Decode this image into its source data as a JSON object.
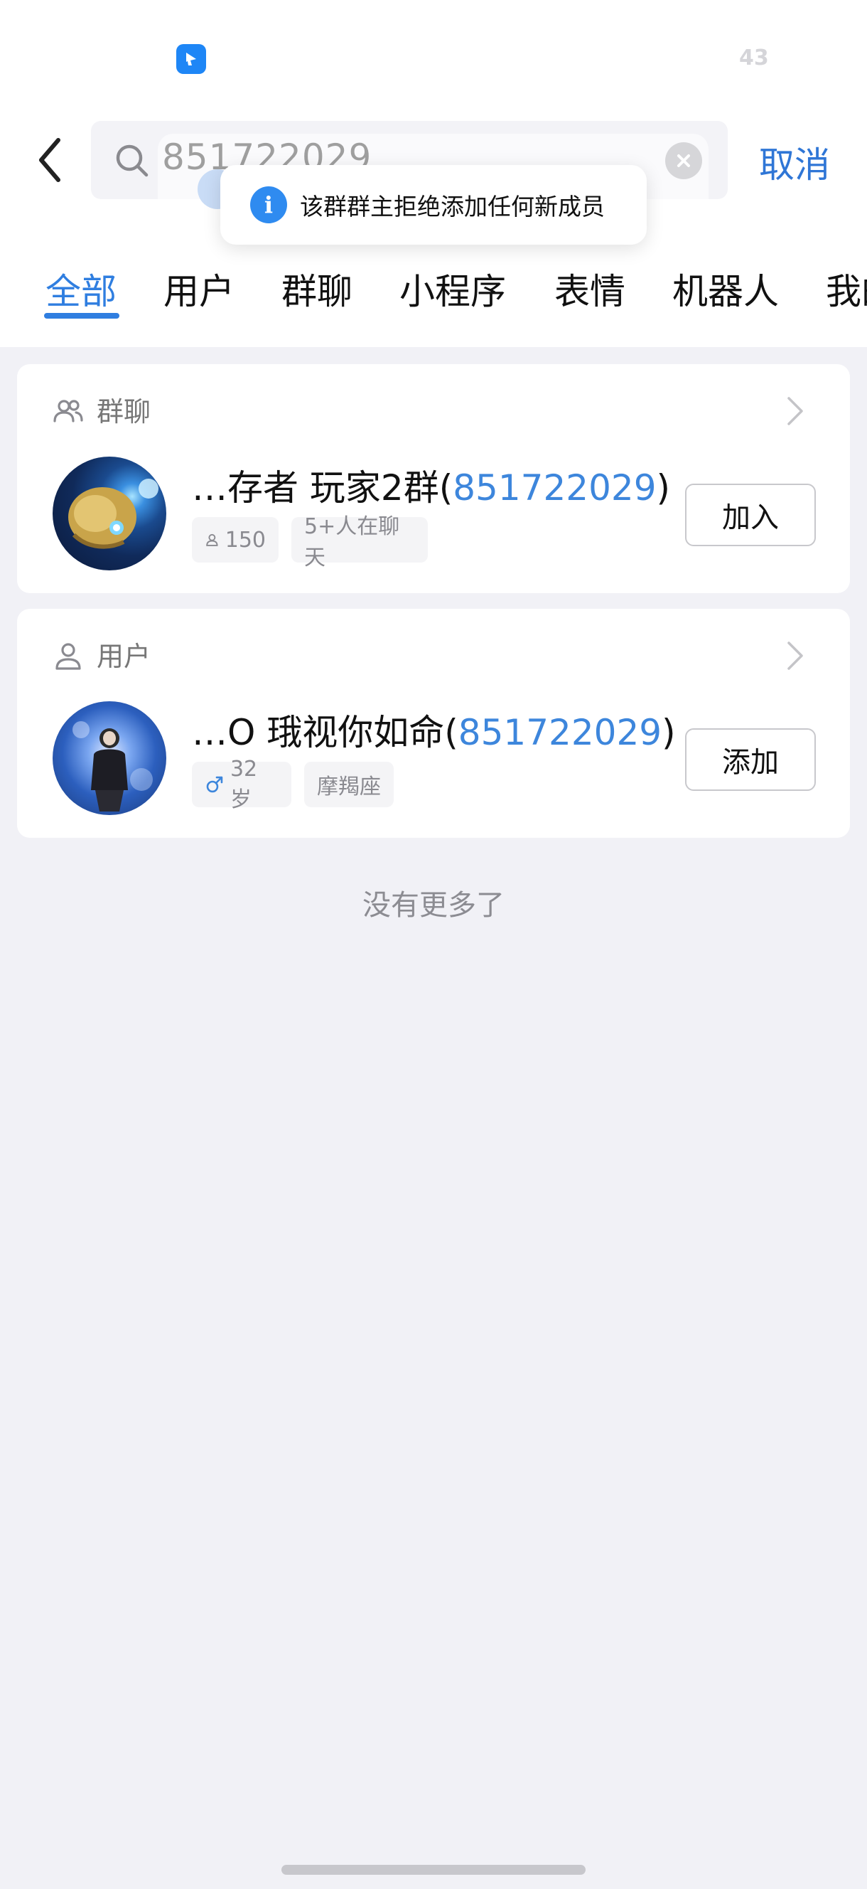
{
  "status_bar": {
    "counter": "43"
  },
  "search": {
    "query": "851722029",
    "cancel_label": "取消"
  },
  "toast": {
    "message": "该群群主拒绝添加任何新成员"
  },
  "tabs": [
    {
      "label": "全部",
      "active": true
    },
    {
      "label": "用户",
      "active": false
    },
    {
      "label": "群聊",
      "active": false
    },
    {
      "label": "小程序",
      "active": false
    },
    {
      "label": "表情",
      "active": false
    },
    {
      "label": "机器人",
      "active": false
    },
    {
      "label": "我的",
      "active": false
    }
  ],
  "group_section": {
    "header": "群聊",
    "result": {
      "title_prefix": "…存者 玩家2群(",
      "title_highlight": "851722029",
      "title_suffix": ")",
      "member_count": "150",
      "active_chip": "5+人在聊天",
      "action_label": "加入"
    }
  },
  "user_section": {
    "header": "用户",
    "result": {
      "title_prefix": "…O 珴视你如命(",
      "title_highlight": "851722029",
      "title_suffix": ")",
      "age_chip": "32岁",
      "zodiac_chip": "摩羯座",
      "action_label": "添加"
    }
  },
  "footer": {
    "no_more": "没有更多了"
  },
  "colors": {
    "accent": "#2f7ee0",
    "highlight": "#3d86dc",
    "toast_icon": "#2f8bf0"
  }
}
